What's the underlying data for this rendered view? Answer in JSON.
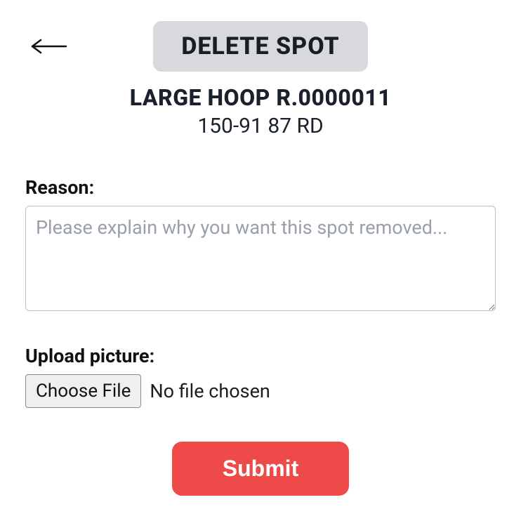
{
  "header": {
    "title": "DELETE SPOT"
  },
  "spot": {
    "name": "LARGE HOOP R.0000011",
    "address": "150-91 87 RD"
  },
  "form": {
    "reason_label": "Reason:",
    "reason_placeholder": "Please explain why you want this spot removed...",
    "reason_value": "",
    "upload_label": "Upload picture:",
    "choose_file_label": "Choose File",
    "file_status": "No file chosen",
    "submit_label": "Submit"
  }
}
